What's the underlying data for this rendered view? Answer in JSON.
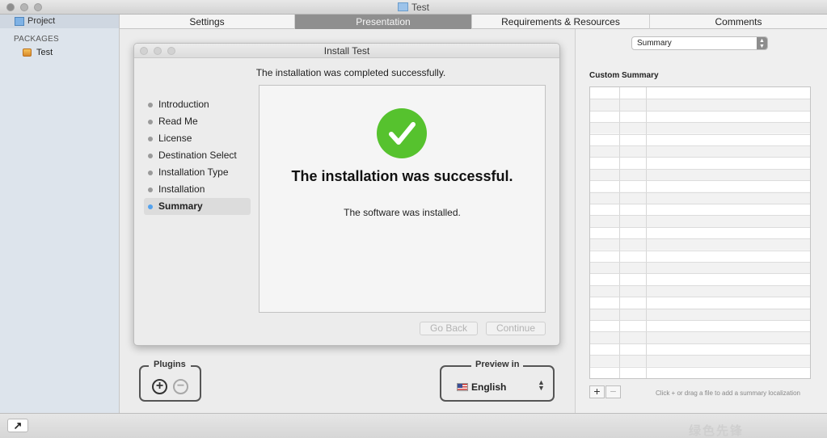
{
  "window": {
    "title": "Test"
  },
  "sidebar": {
    "project_label": "Project",
    "section_heading": "PACKAGES",
    "items": [
      {
        "label": "Test",
        "icon": "package-icon"
      }
    ]
  },
  "tabs": [
    {
      "label": "Settings",
      "active": false
    },
    {
      "label": "Presentation",
      "active": true
    },
    {
      "label": "Requirements & Resources",
      "active": false
    },
    {
      "label": "Comments",
      "active": false
    }
  ],
  "installer": {
    "title": "Install Test",
    "heading": "The installation was completed successfully.",
    "steps": [
      {
        "label": "Introduction",
        "current": false
      },
      {
        "label": "Read Me",
        "current": false
      },
      {
        "label": "License",
        "current": false
      },
      {
        "label": "Destination Select",
        "current": false
      },
      {
        "label": "Installation Type",
        "current": false
      },
      {
        "label": "Installation",
        "current": false
      },
      {
        "label": "Summary",
        "current": true
      }
    ],
    "success_title": "The installation was successful.",
    "success_subtitle": "The software was installed.",
    "go_back_label": "Go Back",
    "continue_label": "Continue",
    "success_color": "#56c22e"
  },
  "plugins": {
    "label": "Plugins",
    "add": "+",
    "remove": "−"
  },
  "preview": {
    "label": "Preview in",
    "language": "English",
    "flag_icon": "us-flag-icon"
  },
  "right_panel": {
    "popup_value": "Summary",
    "heading": "Custom Summary",
    "add_label": "+",
    "remove_label": "−",
    "hint": "Click + or drag a file to add a summary localization"
  },
  "watermark": "绿色先锋 www.greenxf.com"
}
